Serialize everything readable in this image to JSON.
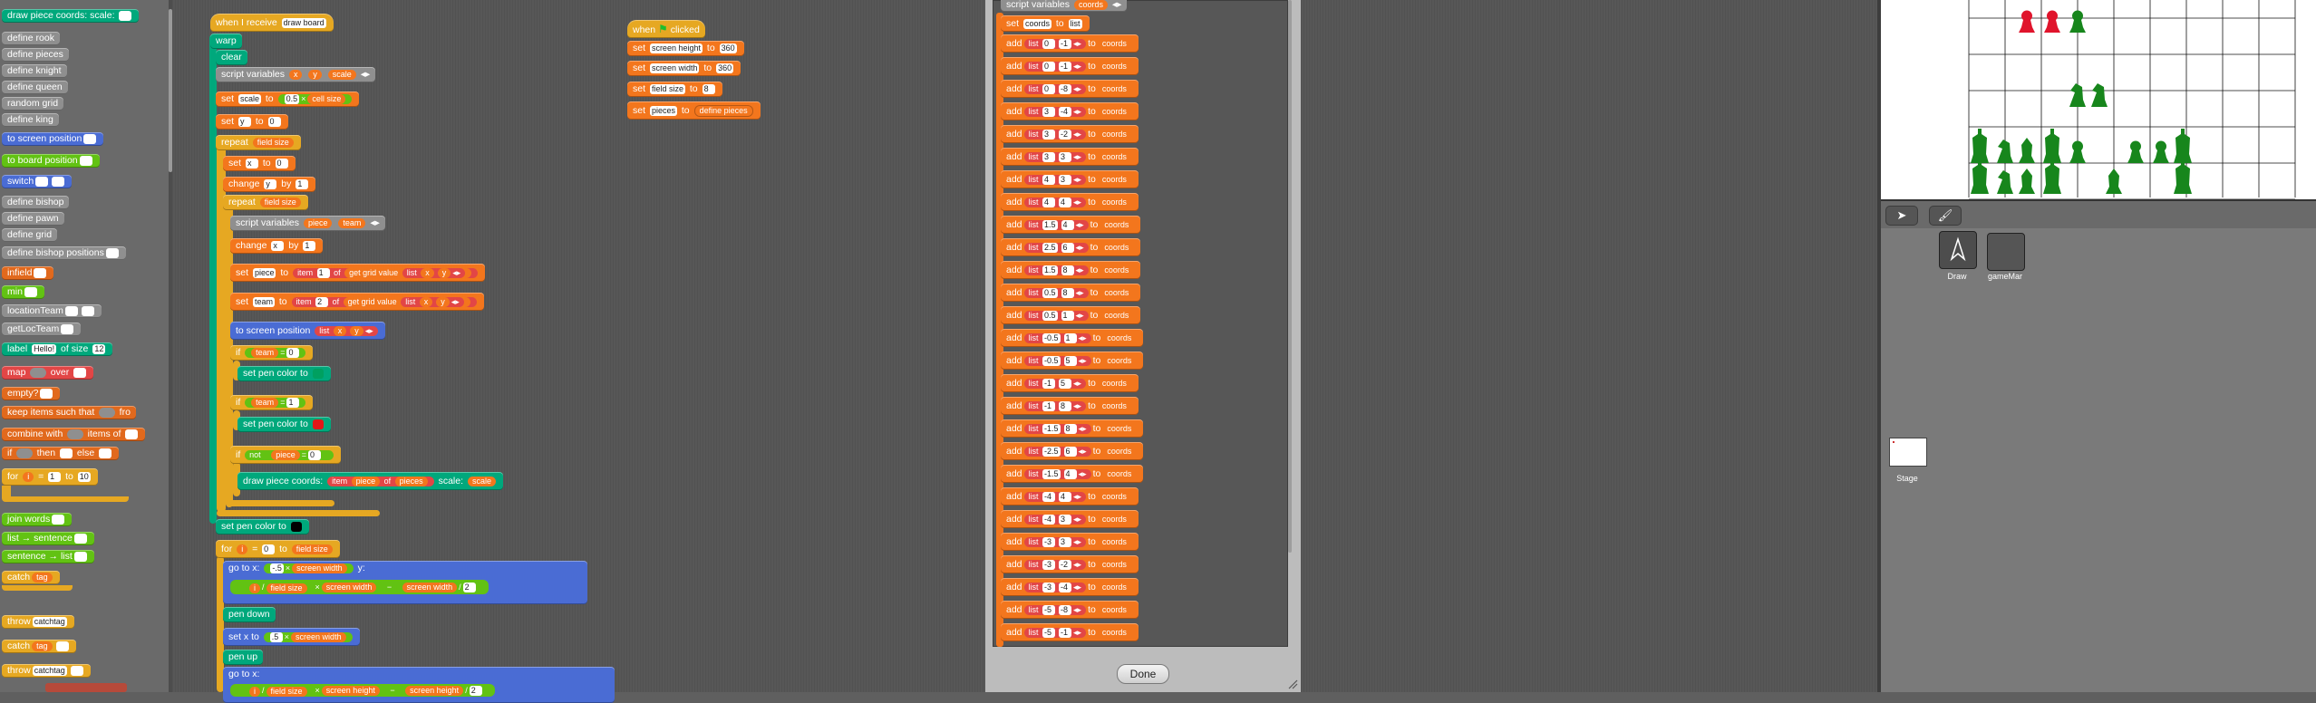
{
  "palette": {
    "items": [
      {
        "label": "draw piece coords:",
        "tail": "scale:",
        "color": "teal"
      },
      {
        "label": "define rook",
        "color": "gray"
      },
      {
        "label": "define pieces",
        "color": "gray"
      },
      {
        "label": "define knight",
        "color": "gray"
      },
      {
        "label": "define queen",
        "color": "gray"
      },
      {
        "label": "random grid",
        "color": "gray"
      },
      {
        "label": "define king",
        "color": "gray"
      },
      {
        "label": "to screen position",
        "color": "blue"
      },
      {
        "label": "to board position",
        "color": "green"
      },
      {
        "label": "switch",
        "color": "blue"
      },
      {
        "label": "define bishop",
        "color": "gray"
      },
      {
        "label": "define pawn",
        "color": "gray"
      },
      {
        "label": "define grid",
        "color": "gray"
      },
      {
        "label": "define bishop positions",
        "color": "gray"
      },
      {
        "label": "infield",
        "color": "orange"
      },
      {
        "label": "min",
        "color": "green"
      },
      {
        "label": "locationTeam",
        "color": "gray"
      },
      {
        "label": "getLocTeam",
        "color": "gray"
      },
      {
        "label": "label",
        "slot": "Hello!",
        "tail": "of size",
        "num": "12",
        "color": "teal"
      },
      {
        "label": "map",
        "tail": "over",
        "color": "red"
      },
      {
        "label": "empty?",
        "color": "orange"
      },
      {
        "label": "keep items such that",
        "tail": "fro",
        "color": "orange"
      },
      {
        "label": "combine with",
        "tail": "items of",
        "color": "orange"
      },
      {
        "label": "if",
        "tail": "then",
        "tail2": "else",
        "color": "orange"
      },
      {
        "label": "for",
        "var": "i",
        "num": "1",
        "tail": "to",
        "num2": "10",
        "color": "yorange"
      },
      {
        "label": "join words",
        "color": "green"
      },
      {
        "label": "list → sentence",
        "color": "green"
      },
      {
        "label": "sentence → list",
        "color": "green"
      },
      {
        "label": "catch",
        "var": "tag",
        "color": "yorange"
      },
      {
        "label": "throw",
        "slot": "catchtag",
        "color": "yorange"
      },
      {
        "label": "catch",
        "var": "tag",
        "color": "yorange"
      },
      {
        "label": "throw",
        "slot": "catchtag",
        "color": "yorange"
      }
    ]
  },
  "script_main": {
    "hat": {
      "label": "when I receive",
      "message": "draw board"
    },
    "warp": "warp",
    "clear": "clear",
    "script_vars": {
      "label": "script variables",
      "vars": [
        "x",
        "y",
        "scale"
      ]
    },
    "set_scale": {
      "label": "set",
      "var": "scale",
      "to": "to",
      "num": "0.5",
      "op": "×",
      "arg": "cell size"
    },
    "set_y": {
      "label": "set",
      "var": "y",
      "to": "to",
      "num": "0"
    },
    "repeat1": {
      "label": "repeat",
      "arg": "field size"
    },
    "set_x": {
      "label": "set",
      "var": "x",
      "to": "to",
      "num": "0"
    },
    "change_y": {
      "label": "change",
      "var": "y",
      "by": "by",
      "num": "1"
    },
    "repeat2": {
      "label": "repeat",
      "arg": "field size"
    },
    "script_vars2": {
      "label": "script variables",
      "vars": [
        "piece",
        "team"
      ]
    },
    "change_x": {
      "label": "change",
      "var": "x",
      "by": "by",
      "num": "1"
    },
    "set_piece": {
      "label": "set",
      "var": "piece",
      "to": "to",
      "item": "item",
      "num": "1",
      "of": "of",
      "fn": "get grid value",
      "list": "list",
      "a": "x",
      "b": "y"
    },
    "set_team": {
      "label": "set",
      "var": "team",
      "to": "to",
      "item": "item",
      "num": "2",
      "of": "of",
      "fn": "get grid value",
      "list": "list",
      "a": "x",
      "b": "y"
    },
    "to_screen": {
      "label": "to screen position",
      "list": "list",
      "a": "x",
      "b": "y"
    },
    "if1": {
      "label": "if",
      "var": "team",
      "op": "=",
      "num": "0"
    },
    "pen_color1": {
      "label": "set pen color to",
      "color": "#00a060"
    },
    "if2": {
      "label": "if",
      "var": "team",
      "op": "=",
      "num": "1"
    },
    "pen_color2": {
      "label": "set pen color to",
      "color": "#e01818"
    },
    "if3": {
      "label": "if",
      "not": "not",
      "var": "piece",
      "op": "=",
      "num": "0"
    },
    "draw_piece": {
      "label": "draw piece coords:",
      "item": "item",
      "var": "piece",
      "of": "of",
      "list": "pieces",
      "scale": "scale:",
      "arg": "scale"
    },
    "set_pen_black": {
      "label": "set pen color to",
      "color": "#000000"
    },
    "for": {
      "label": "for",
      "var": "i",
      "eq": "=",
      "num": "0",
      "to": "to",
      "arg": "field size"
    },
    "goto1": {
      "label": "go to x:",
      "num": "-.5",
      "op": "×",
      "arg": "screen width",
      "y": "y:"
    },
    "goto1b": {
      "a": "i",
      "div": "/",
      "b": "field size",
      "mul": "×",
      "c": "screen width",
      "minus": "−",
      "d": "screen width",
      "div2": "/",
      "num": "2"
    },
    "pen_down": "pen down",
    "set_x_to": {
      "label": "set x to",
      "num": ".5",
      "op": "×",
      "arg": "screen width"
    },
    "pen_up": "pen up",
    "goto2": {
      "label": "go to x:"
    },
    "goto2b": {
      "a": "i",
      "div": "/",
      "b": "field size",
      "mul": "×",
      "c": "screen height",
      "minus": "−",
      "d": "screen height",
      "div2": "/",
      "num": "2"
    }
  },
  "script_flag": {
    "hat": "when",
    "hat2": "clicked",
    "rows": [
      {
        "label": "set",
        "var": "screen height",
        "to": "to",
        "num": "360"
      },
      {
        "label": "set",
        "var": "screen width",
        "to": "to",
        "num": "360"
      },
      {
        "label": "set",
        "var": "field size",
        "to": "to",
        "num": "8"
      },
      {
        "label": "set",
        "var": "pieces",
        "to": "to",
        "arg": "define pieces"
      }
    ]
  },
  "dialog": {
    "script_vars": {
      "label": "script variables",
      "var": "coords"
    },
    "set_coords": {
      "label": "set",
      "var": "coords",
      "to": "to",
      "arg": "list"
    },
    "add_label": "add",
    "list_label": "list",
    "to_label": "to",
    "target": "coords",
    "rows": [
      [
        "0",
        "-1"
      ],
      [
        "0",
        "-1"
      ],
      [
        "0",
        "-8"
      ],
      [
        "3",
        "-4"
      ],
      [
        "3",
        "-2"
      ],
      [
        "3",
        "3"
      ],
      [
        "4",
        "3"
      ],
      [
        "4",
        "4"
      ],
      [
        "1.5",
        "4"
      ],
      [
        "2.5",
        "6"
      ],
      [
        "1.5",
        "8"
      ],
      [
        "0.5",
        "8"
      ],
      [
        "0.5",
        "1"
      ],
      [
        "-0.5",
        "1"
      ],
      [
        "-0.5",
        "5"
      ],
      [
        "-1",
        "5"
      ],
      [
        "-1",
        "8"
      ],
      [
        "-1.5",
        "8"
      ],
      [
        "-2.5",
        "6"
      ],
      [
        "-1.5",
        "4"
      ],
      [
        "-4",
        "4"
      ],
      [
        "-4",
        "3"
      ],
      [
        "-3",
        "3"
      ],
      [
        "-3",
        "-2"
      ],
      [
        "-3",
        "-4"
      ],
      [
        "-5",
        "-8"
      ],
      [
        "-5",
        "-1"
      ]
    ],
    "done": "Done"
  },
  "corral": {
    "arrow_icon": "arrow-icon",
    "brush_icon": "paintbrush-icon",
    "sprites": [
      {
        "name": "Draw"
      },
      {
        "name": "gameMar"
      }
    ],
    "stage_label": "Stage"
  },
  "stage_board": {
    "red_pieces": [
      "pawn",
      "pawn"
    ],
    "green_pieces_row1": [
      "pawn"
    ],
    "green_pieces_row3": [
      "knight",
      "knight"
    ],
    "green_pieces_row4": [
      "king",
      "knight",
      "bishop",
      "king",
      "pawn",
      "pawn",
      "pawn",
      "king"
    ],
    "green_pieces_row5": [
      "bishop"
    ],
    "colors": {
      "red": "#e0142c",
      "green": "#17861c"
    }
  }
}
